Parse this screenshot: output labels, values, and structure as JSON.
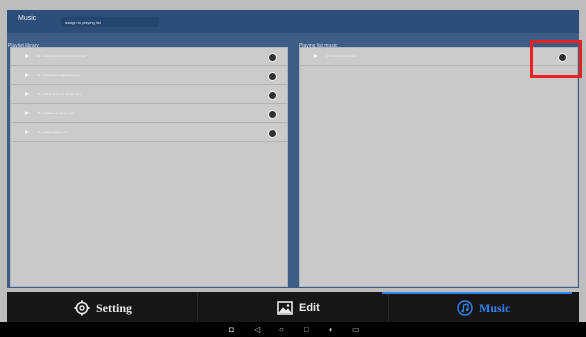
{
  "header": {
    "title": "Music",
    "tab_label": "assign to playing list"
  },
  "left_panel": {
    "header": "Playlist library",
    "items": [
      {
        "label": "01 - Lorem ipsum dolor sit amet.mp3"
      },
      {
        "label": "02 - consectetur adipiscing.mp3"
      },
      {
        "label": "03 - sed do eiusmod tempor.mp3"
      },
      {
        "label": "04 - ut labore et dolore.mp3"
      },
      {
        "label": "05 - magna aliqua.mp3"
      }
    ]
  },
  "right_panel": {
    "header": "Playing list music",
    "items": [
      {
        "label": "01 - Lorem ipsum.mp3"
      }
    ]
  },
  "bottom_nav": {
    "setting_label": "Setting",
    "edit_label": "Edit",
    "music_label": "Music"
  },
  "colors": {
    "topbar": "#2c4e79",
    "content_bg": "#3d5c86",
    "panel_bg": "#c9c9c9",
    "active_accent": "#2f84f0",
    "highlight": "#e6221f",
    "bottom_bar": "#161616"
  },
  "icons": {
    "setting": "gear-icon",
    "edit": "image-icon",
    "music": "music-note-icon",
    "row_play": "play-icon",
    "row_action": "toggle-knob-icon"
  }
}
